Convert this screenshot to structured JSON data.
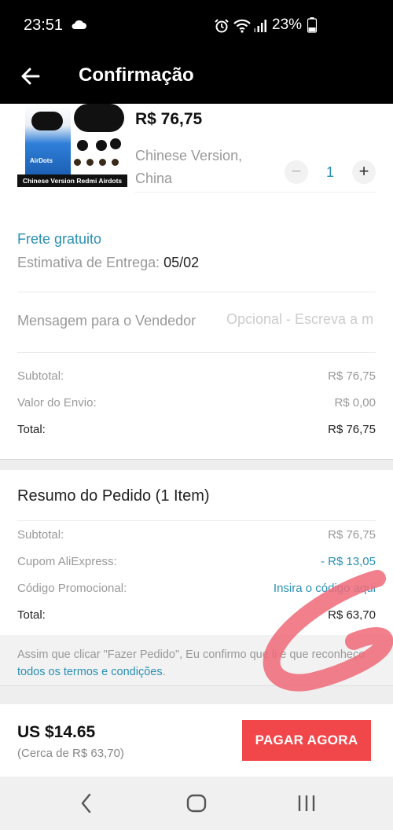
{
  "status_bar": {
    "time": "23:51",
    "battery": "23%",
    "icons": [
      "cloud-icon",
      "alarm-icon",
      "wifi-icon",
      "signal-icon",
      "battery-icon"
    ]
  },
  "app_bar": {
    "title": "Confirmação",
    "back_icon": "arrow-left-icon"
  },
  "product": {
    "image_caption": "Chinese Version Redmi Airdots",
    "box_label": "AirDots",
    "price": "R$ 76,75",
    "variant": "Chinese Version, China",
    "quantity": "1",
    "minus": "−",
    "plus": "+"
  },
  "shipping": {
    "free_label": "Frete gratuito",
    "estimate_label": "Estimativa de Entrega:",
    "estimate_date": "05/02"
  },
  "message": {
    "label": "Mensagem para o Vendedor",
    "placeholder": "Opcional - Escreva a m"
  },
  "seller_totals": {
    "subtotal_label": "Subtotal:",
    "subtotal_value": "R$ 76,75",
    "shipping_label": "Valor do Envio:",
    "shipping_value": "R$ 0,00",
    "total_label": "Total:",
    "total_value": "R$ 76,75"
  },
  "summary": {
    "title": "Resumo do Pedido (1 Item)",
    "subtotal_label": "Subtotal:",
    "subtotal_value": "R$ 76,75",
    "coupon_label": "Cupom AliExpress:",
    "coupon_value": "- R$ 13,05",
    "promo_label": "Código Promocional:",
    "promo_value": "Insira o código aqui",
    "total_label": "Total:",
    "total_value": "R$ 63,70"
  },
  "terms": {
    "text": "Assim que clicar \"Fazer Pedido\", Eu confirmo que li e que reconheço",
    "link": "todos os termos e condições",
    "end": "."
  },
  "footer": {
    "usd_total": "US $14.65",
    "approx": "(Cerca de R$ 63,70)",
    "pay_button": "PAGAR AGORA"
  },
  "colors": {
    "accent": "#2a8fb5",
    "pay_button": "#f2474a",
    "annotation": "#f06a78"
  },
  "nav_bar": {
    "icons": [
      "nav-back-icon",
      "nav-home-icon",
      "nav-recents-icon"
    ]
  }
}
